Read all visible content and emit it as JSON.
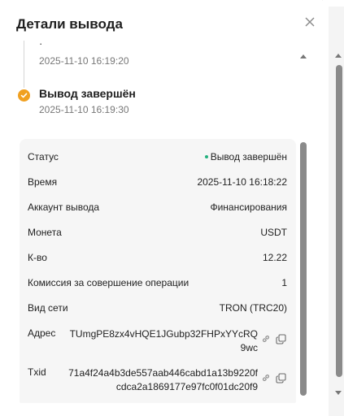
{
  "header": {
    "title": "Детали вывода"
  },
  "timeline": {
    "prev_time": "2025-11-10 16:19:20",
    "current_title": "Вывод завершён",
    "current_time": "2025-11-10 16:19:30"
  },
  "details": {
    "status_label": "Статус",
    "status_value": "Вывод завершён",
    "time_label": "Время",
    "time_value": "2025-11-10 16:18:22",
    "account_label": "Аккаунт вывода",
    "account_value": "Финансирования",
    "coin_label": "Монета",
    "coin_value": "USDT",
    "qty_label": "К-во",
    "qty_value": "12.22",
    "fee_label": "Комиссия за совершение операции",
    "fee_value": "1",
    "network_label": "Вид сети",
    "network_value": "TRON (TRC20)",
    "address_label": "Адрес",
    "address_value": "TUmgPE8zx4vHQE1JGubp32FHPxYYcRQ9wc",
    "txid_label": "Txid",
    "txid_value": "71a4f24a4b3de557aab446cabd1a13b9220fcdca2a1869177e97fc0f01dc20f9"
  },
  "colors": {
    "status_green": "#22b07d",
    "timeline_check": "#f0a020",
    "panel_background": "#f6f6f6"
  },
  "icons": [
    "close-icon",
    "check-icon",
    "link-icon",
    "copy-icon"
  ]
}
